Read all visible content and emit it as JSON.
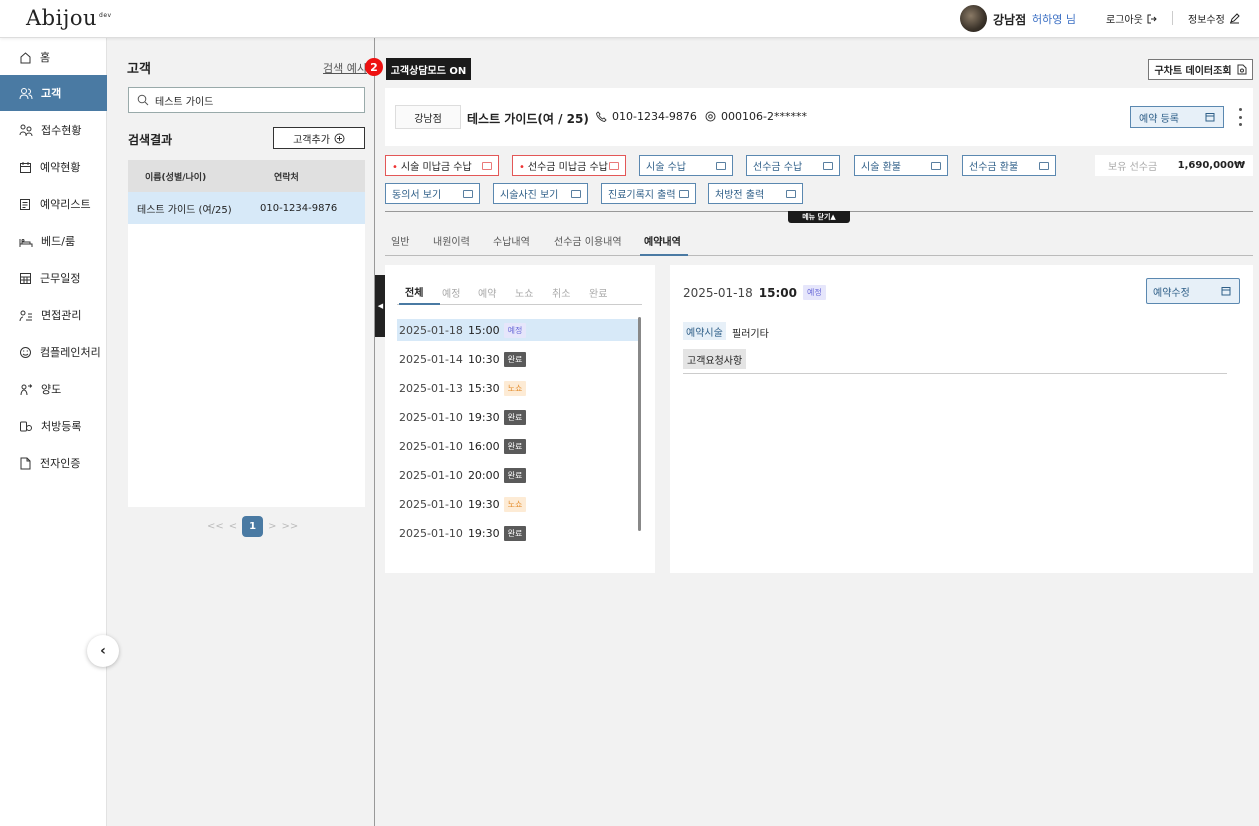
{
  "header": {
    "logo": "Abijou",
    "logo_sup": "dev",
    "branch": "강남점",
    "user": "허하영 님",
    "logout": "로그아웃",
    "edit_info": "정보수정"
  },
  "sidebar": {
    "items": [
      {
        "label": "홈",
        "icon": "home-icon"
      },
      {
        "label": "고객",
        "icon": "users-icon",
        "active": true
      },
      {
        "label": "접수현황",
        "icon": "reception-icon"
      },
      {
        "label": "예약현황",
        "icon": "calendar-icon"
      },
      {
        "label": "예약리스트",
        "icon": "list-icon"
      },
      {
        "label": "베드/룸",
        "icon": "bed-icon"
      },
      {
        "label": "근무일정",
        "icon": "schedule-icon"
      },
      {
        "label": "면접관리",
        "icon": "interview-icon"
      },
      {
        "label": "컴플레인처리",
        "icon": "smile-icon"
      },
      {
        "label": "양도",
        "icon": "transfer-icon"
      },
      {
        "label": "처방등록",
        "icon": "prescription-icon"
      },
      {
        "label": "전자인증",
        "icon": "document-icon"
      }
    ],
    "collapse_glyph": "‹"
  },
  "customer_panel": {
    "title": "고객",
    "search_example": "검색 예시",
    "search_value": "테스트 가이드",
    "result_label": "검색결과",
    "add_button": "고객추가",
    "columns": [
      "이름(성별/나이)",
      "연락처"
    ],
    "rows": [
      {
        "name": "테스트 가이드 (여/25)",
        "phone": "010-1234-9876"
      }
    ],
    "pager": {
      "first": "<<",
      "prev": "<",
      "current": "1",
      "next": ">",
      "last": ">>"
    }
  },
  "consult": {
    "number": "2",
    "label": "고객상담모드 ON",
    "chart_button": "구차트 데이터조회"
  },
  "info": {
    "branch": "강남점",
    "name": "테스트 가이드(여 / 25)",
    "phone": "010-1234-9876",
    "rrn": "000106-2******",
    "reserve_button": "예약 등록"
  },
  "actions": {
    "row1": [
      "시술 미납금 수납",
      "선수금 미납금 수납",
      "시술 수납",
      "선수금 수납",
      "시술 환불",
      "선수금 환불"
    ],
    "row2": [
      "동의서 보기",
      "시술사진 보기",
      "진료기록지 출력",
      "처방전 출력"
    ],
    "prepaid_label": "보유 선수금",
    "prepaid_value": "1,690,000₩",
    "menu_close": "메뉴 닫기▲"
  },
  "tabs": [
    "일반",
    "내원이력",
    "수납내역",
    "선수금 이용내역",
    "예약내역"
  ],
  "active_tab": "예약내역",
  "reservations": {
    "filters": [
      "전체",
      "예정",
      "예약",
      "노쇼",
      "취소",
      "완료"
    ],
    "rows": [
      {
        "date": "2025-01-18",
        "time": "15:00",
        "status": "예정",
        "kind": "sched"
      },
      {
        "date": "2025-01-14",
        "time": "10:30",
        "status": "완료",
        "kind": "done"
      },
      {
        "date": "2025-01-13",
        "time": "15:30",
        "status": "노쇼",
        "kind": "noshow"
      },
      {
        "date": "2025-01-10",
        "time": "19:30",
        "status": "완료",
        "kind": "done"
      },
      {
        "date": "2025-01-10",
        "time": "16:00",
        "status": "완료",
        "kind": "done"
      },
      {
        "date": "2025-01-10",
        "time": "20:00",
        "status": "완료",
        "kind": "done"
      },
      {
        "date": "2025-01-10",
        "time": "19:30",
        "status": "노쇼",
        "kind": "noshow"
      },
      {
        "date": "2025-01-10",
        "time": "19:30",
        "status": "완료",
        "kind": "done"
      }
    ]
  },
  "detail": {
    "date": "2025-01-18",
    "time": "15:00",
    "status": "예정",
    "edit_button": "예약수정",
    "procedure_label": "예약시술",
    "procedure_value": "필러기타",
    "request_label": "고객요청사항"
  },
  "colors": {
    "accent": "#4a7aa3",
    "selected_row": "#d7e9f8",
    "red_border": "#e35757",
    "consult_badge": "#ee1111"
  }
}
